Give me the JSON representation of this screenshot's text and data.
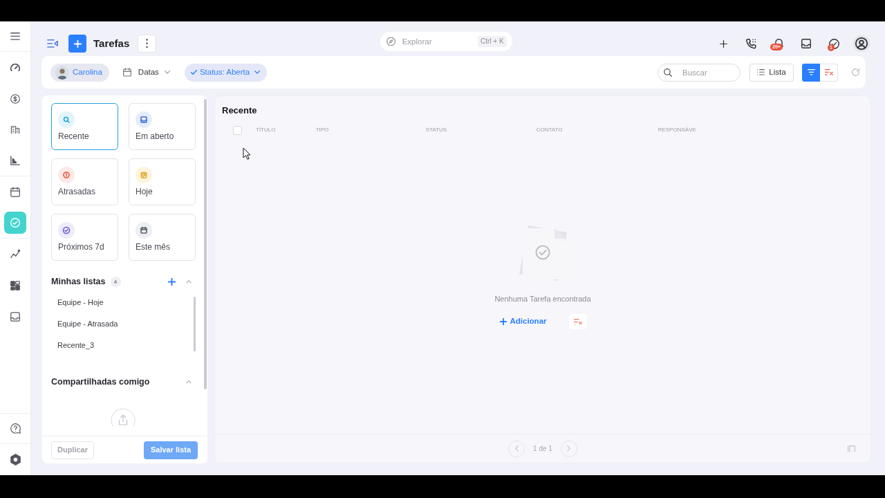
{
  "sidebar": {
    "sections": [
      {
        "items": [
          {
            "selected": false
          },
          {
            "selected": false
          },
          {
            "selected": false
          },
          {
            "selected": false
          }
        ]
      },
      {
        "items": [
          {
            "selected": false
          },
          {
            "selected": true
          }
        ]
      },
      {
        "items": [
          {
            "selected": false
          },
          {
            "selected": false
          },
          {
            "selected": false
          }
        ]
      }
    ],
    "bottom": [
      {
        "selected": false
      },
      {
        "selected": false
      }
    ]
  },
  "header": {
    "title": "Tarefas",
    "explore": {
      "placeholder": "Explorar",
      "shortcut": "Ctrl + K"
    },
    "notifications_badge": "20+",
    "tasks_badge": "1"
  },
  "filters": {
    "chips": [
      {
        "kind": "user",
        "label": "Carolina"
      },
      {
        "kind": "dropdown",
        "label": "Datas"
      },
      {
        "kind": "status",
        "label": "Status: Aberta"
      }
    ],
    "search": {
      "placeholder": "Buscar"
    },
    "view_button": "Lista",
    "filter_active": true
  },
  "quick_views": [
    {
      "label": "Recente",
      "selected": true
    },
    {
      "label": "Em aberto",
      "selected": false
    },
    {
      "label": "Atrasadas",
      "selected": false
    },
    {
      "label": "Hoje",
      "selected": false
    },
    {
      "label": "Próximos 7d",
      "selected": false
    },
    {
      "label": "Este mês",
      "selected": false
    }
  ],
  "my_lists": {
    "title": "Minhas listas",
    "count": "4",
    "expanded": true,
    "items": [
      {
        "label": "Equipe - Hoje"
      },
      {
        "label": "Equipe - Atrasada"
      },
      {
        "label": "Recente_3"
      }
    ]
  },
  "shared_lists": {
    "title": "Compartilhadas comigo",
    "expanded": true
  },
  "panel_actions": [
    {
      "label": "Duplicar",
      "kind": "secondary",
      "disabled": true
    },
    {
      "label": "Salvar lista",
      "kind": "primary",
      "disabled": true
    }
  ],
  "main": {
    "title": "Recente",
    "select_all": {
      "checked": false
    },
    "columns": [
      "TÍTULO",
      "TIPO",
      "STATUS",
      "CONTATO",
      "RESPONSÁVE"
    ],
    "empty": {
      "message": "Nenhuma Tarefa encontrada",
      "action": "Adicionar"
    },
    "pagination": {
      "label": "1 de 1"
    }
  }
}
